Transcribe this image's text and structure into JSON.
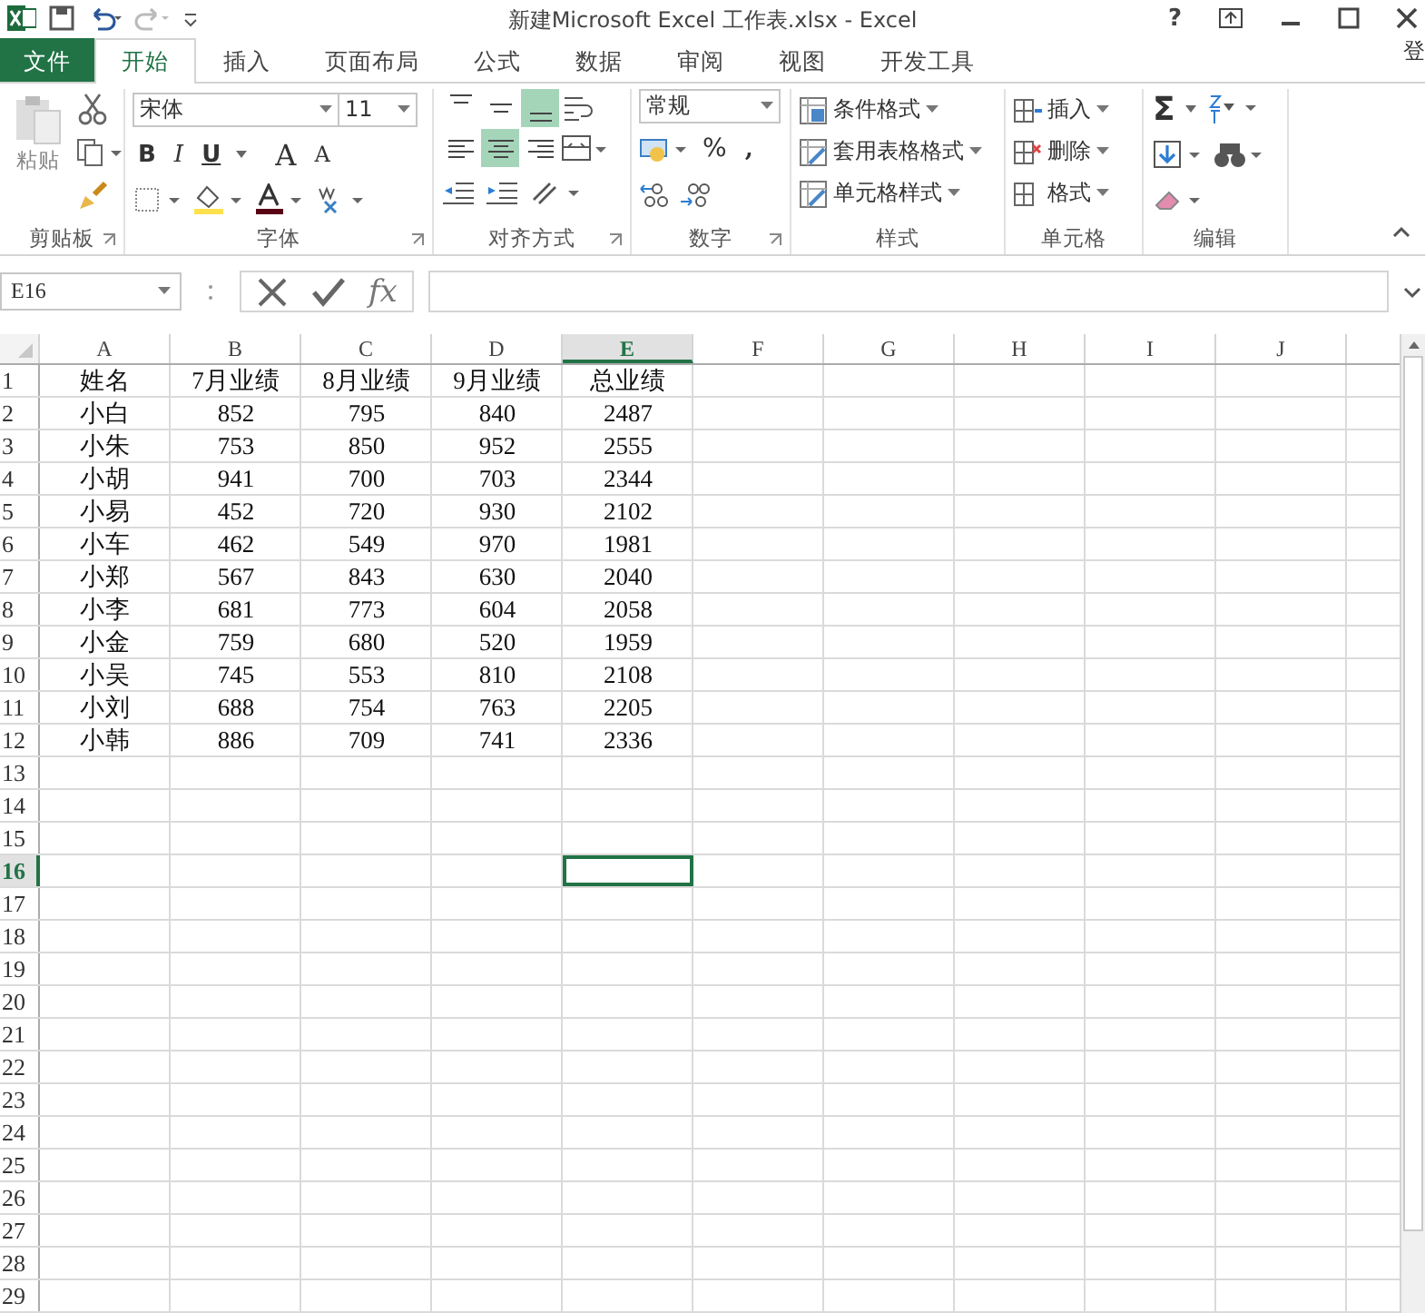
{
  "window": {
    "title": "新建Microsoft Excel 工作表.xlsx - Excel",
    "help": "?"
  },
  "tabs": [
    {
      "label": "文件",
      "kind": "file",
      "selected": false
    },
    {
      "label": "开始",
      "kind": "tab",
      "selected": true
    },
    {
      "label": "插入",
      "kind": "tab",
      "selected": false
    },
    {
      "label": "页面布局",
      "kind": "tab",
      "selected": false
    },
    {
      "label": "公式",
      "kind": "tab",
      "selected": false
    },
    {
      "label": "数据",
      "kind": "tab",
      "selected": false
    },
    {
      "label": "审阅",
      "kind": "tab",
      "selected": false
    },
    {
      "label": "视图",
      "kind": "tab",
      "selected": false
    },
    {
      "label": "开发工具",
      "kind": "tab",
      "selected": false
    }
  ],
  "account": "登",
  "ribbon": {
    "clipboard": {
      "paste": "粘贴",
      "label": "剪贴板"
    },
    "font": {
      "name": "宋体",
      "size": "11",
      "bold": "B",
      "italic": "I",
      "underline": "U",
      "grow": "A",
      "shrink": "A",
      "label": "字体"
    },
    "alignment": {
      "buttons": [
        {
          "selected": false
        },
        {
          "selected": false
        },
        {
          "selected": true
        },
        {
          "selected": false
        },
        {
          "selected": true
        },
        {
          "selected": false
        }
      ],
      "label": "对齐方式"
    },
    "number": {
      "format": "常规",
      "percent": "%",
      "comma": ",",
      "label": "数字"
    },
    "styles": {
      "items": [
        "条件格式",
        "套用表格格式",
        "单元格样式"
      ],
      "label": "样式"
    },
    "cells": {
      "items": [
        "插入",
        "删除",
        "格式"
      ],
      "label": "单元格"
    },
    "editing": {
      "sum": "Σ",
      "label": "编辑"
    }
  },
  "formula_bar": {
    "name_box": "E16",
    "fx": "fx"
  },
  "sheet": {
    "columns": [
      {
        "label": "A",
        "selected": false
      },
      {
        "label": "B",
        "selected": false
      },
      {
        "label": "C",
        "selected": false
      },
      {
        "label": "D",
        "selected": false
      },
      {
        "label": "E",
        "selected": true
      },
      {
        "label": "F",
        "selected": false
      },
      {
        "label": "G",
        "selected": false
      },
      {
        "label": "H",
        "selected": false
      },
      {
        "label": "I",
        "selected": false
      },
      {
        "label": "J",
        "selected": false
      }
    ],
    "rows": [
      {
        "number": "1",
        "selected": false,
        "cells": [
          "姓名",
          "7月业绩",
          "8月业绩",
          "9月业绩",
          "总业绩"
        ]
      },
      {
        "number": "2",
        "selected": false,
        "cells": [
          "小白",
          "852",
          "795",
          "840",
          "2487"
        ]
      },
      {
        "number": "3",
        "selected": false,
        "cells": [
          "小朱",
          "753",
          "850",
          "952",
          "2555"
        ]
      },
      {
        "number": "4",
        "selected": false,
        "cells": [
          "小胡",
          "941",
          "700",
          "703",
          "2344"
        ]
      },
      {
        "number": "5",
        "selected": false,
        "cells": [
          "小易",
          "452",
          "720",
          "930",
          "2102"
        ]
      },
      {
        "number": "6",
        "selected": false,
        "cells": [
          "小车",
          "462",
          "549",
          "970",
          "1981"
        ]
      },
      {
        "number": "7",
        "selected": false,
        "cells": [
          "小郑",
          "567",
          "843",
          "630",
          "2040"
        ]
      },
      {
        "number": "8",
        "selected": false,
        "cells": [
          "小李",
          "681",
          "773",
          "604",
          "2058"
        ]
      },
      {
        "number": "9",
        "selected": false,
        "cells": [
          "小金",
          "759",
          "680",
          "520",
          "1959"
        ]
      },
      {
        "number": "10",
        "selected": false,
        "cells": [
          "小吴",
          "745",
          "553",
          "810",
          "2108"
        ]
      },
      {
        "number": "11",
        "selected": false,
        "cells": [
          "小刘",
          "688",
          "754",
          "763",
          "2205"
        ]
      },
      {
        "number": "12",
        "selected": false,
        "cells": [
          "小韩",
          "886",
          "709",
          "741",
          "2336"
        ]
      },
      {
        "number": "13",
        "selected": false
      },
      {
        "number": "14",
        "selected": false
      },
      {
        "number": "15",
        "selected": false
      },
      {
        "number": "16",
        "selected": true
      },
      {
        "number": "17",
        "selected": false
      },
      {
        "number": "18",
        "selected": false
      },
      {
        "number": "19",
        "selected": false
      },
      {
        "number": "20",
        "selected": false
      },
      {
        "number": "21",
        "selected": false
      },
      {
        "number": "22",
        "selected": false
      },
      {
        "number": "23",
        "selected": false
      },
      {
        "number": "24",
        "selected": false
      },
      {
        "number": "25",
        "selected": false
      },
      {
        "number": "26",
        "selected": false
      },
      {
        "number": "27",
        "selected": false
      },
      {
        "number": "28",
        "selected": false
      },
      {
        "number": "29",
        "selected": false
      }
    ]
  }
}
